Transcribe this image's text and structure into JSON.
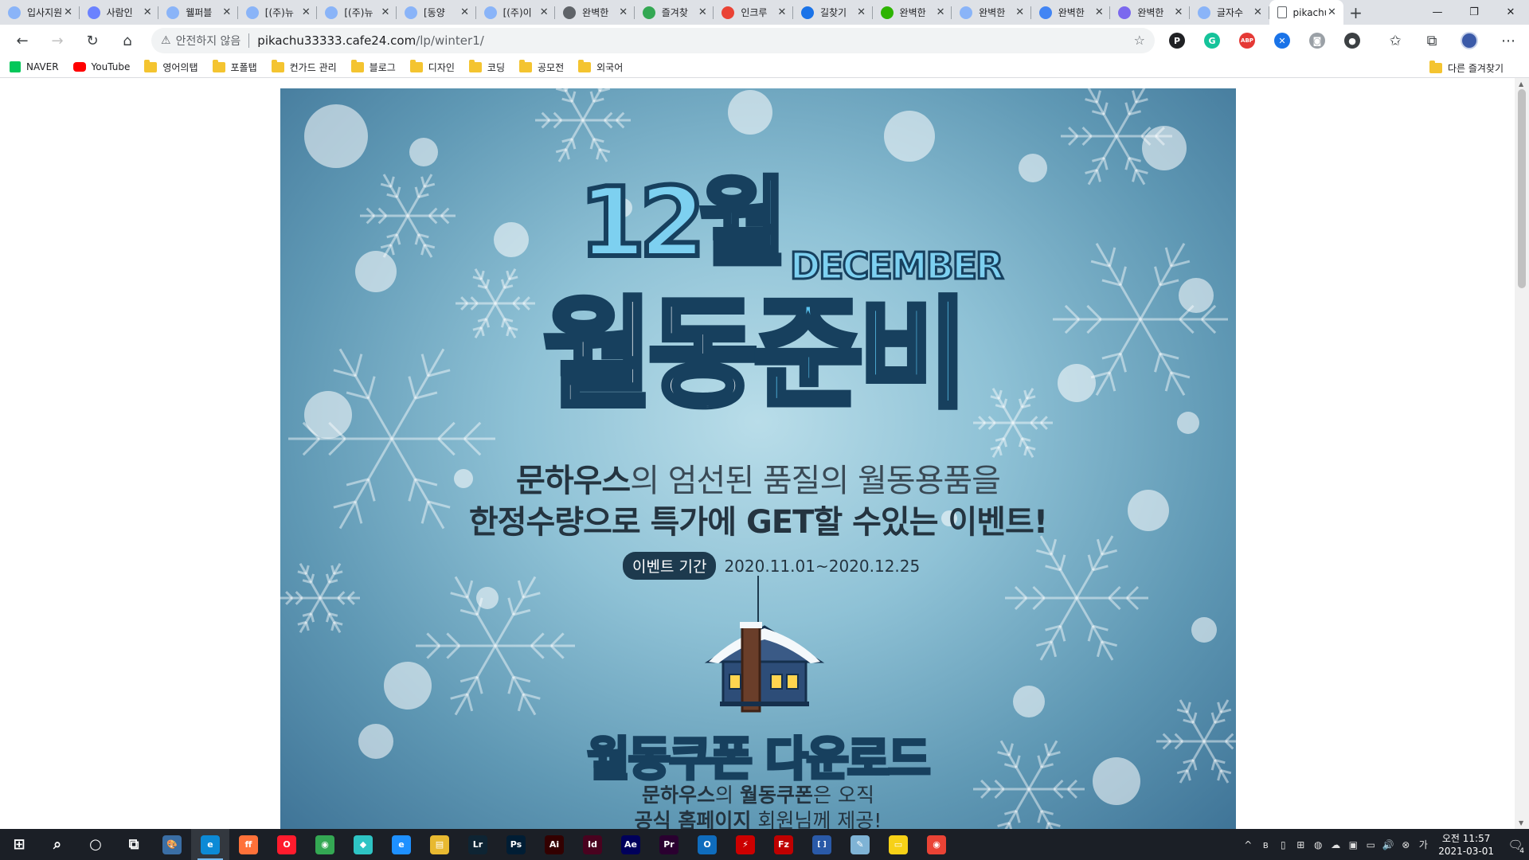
{
  "tabs": [
    {
      "title": "입사지원",
      "color": "#8ab4f8"
    },
    {
      "title": "사람인",
      "color": "#6b82ff"
    },
    {
      "title": "웰퍼블",
      "color": "#8ab4f8"
    },
    {
      "title": "[(주)뉴",
      "color": "#8ab4f8"
    },
    {
      "title": "[(주)뉴",
      "color": "#8ab4f8"
    },
    {
      "title": "[동양",
      "color": "#8ab4f8"
    },
    {
      "title": "[(주)이",
      "color": "#8ab4f8"
    },
    {
      "title": "완벽한",
      "color": "#5f6368"
    },
    {
      "title": "즐겨찾",
      "color": "#34a853"
    },
    {
      "title": "인크루",
      "color": "#ea4335"
    },
    {
      "title": "길찾기",
      "color": "#1a73e8"
    },
    {
      "title": "완벽한",
      "color": "#2db400"
    },
    {
      "title": "완벽한",
      "color": "#8ab4f8"
    },
    {
      "title": "완벽한",
      "color": "#4285f4"
    },
    {
      "title": "완벽한",
      "color": "#7b68ee"
    },
    {
      "title": "글자수",
      "color": "#8ab4f8"
    }
  ],
  "active_tab": {
    "title": "pikachu",
    "close": "✕"
  },
  "tab_close": "✕",
  "new_tab": "+",
  "window_controls": {
    "minimize": "—",
    "maximize": "❐",
    "close": "✕"
  },
  "toolbar": {
    "back": "←",
    "forward": "→",
    "reload": "↻",
    "home": "⌂",
    "security_icon": "⚠",
    "security_text": "안전하지 않음",
    "url_host": "pikachu33333.cafe24.com",
    "url_path": "/lp/winter1/",
    "star": "☆",
    "extensions": [
      {
        "name": "extension-p-icon",
        "label": "P",
        "color": "#202124"
      },
      {
        "name": "extension-grammarly-icon",
        "label": "G",
        "color": "#15c39a"
      },
      {
        "name": "extension-adblock-icon",
        "label": "ABP",
        "color": "#e53935"
      },
      {
        "name": "extension-x-icon",
        "label": "✕",
        "color": "#1a73e8"
      },
      {
        "name": "extension-camera-icon",
        "label": "◙",
        "color": "#9aa0a6"
      },
      {
        "name": "extension-circle-icon",
        "label": "●",
        "color": "#3c4043"
      }
    ],
    "favorites": "✩",
    "collections": "⧉",
    "menu": "⋯"
  },
  "bookmarks": [
    {
      "label": "NAVER",
      "type": "naver"
    },
    {
      "label": "YouTube",
      "type": "youtube"
    },
    {
      "label": "영어의탭",
      "type": "folder"
    },
    {
      "label": "포폴탭",
      "type": "folder"
    },
    {
      "label": "컨가드 관리",
      "type": "folder"
    },
    {
      "label": "블로그",
      "type": "folder"
    },
    {
      "label": "디자인",
      "type": "folder"
    },
    {
      "label": "코딩",
      "type": "folder"
    },
    {
      "label": "공모전",
      "type": "folder"
    },
    {
      "label": "외국어",
      "type": "folder"
    }
  ],
  "other_bookmarks": "다른 즐겨찾기",
  "banner": {
    "month": "12월",
    "month_en": "DECEMBER",
    "headline_white": "월동",
    "headline_blue": "준비",
    "line1_bold": "문하우스",
    "line1_rest": "의 엄선된 품질의 월동용품을",
    "line2": "한정수량으로 특가에 GET할 수있는 이벤트!",
    "period_label": "이벤트 기간",
    "period_dates": "2020.11.01~2020.12.25",
    "coupon_title": "월동쿠폰 다운로드",
    "coupon_line1_bold_a": "문하우스",
    "coupon_line1_mid": "의 ",
    "coupon_line1_bold_b": "월동쿠폰",
    "coupon_line1_rest": "은 오직",
    "coupon_line2_bold": "공식 홈페이지",
    "coupon_line2_rest": " 회원님께 제공!"
  },
  "taskbar": {
    "apps": [
      {
        "name": "start-icon",
        "label": "⊞",
        "color": "transparent"
      },
      {
        "name": "search-icon",
        "label": "⌕",
        "color": "transparent"
      },
      {
        "name": "cortana-icon",
        "label": "○",
        "color": "transparent"
      },
      {
        "name": "task-view-icon",
        "label": "⧉",
        "color": "transparent"
      },
      {
        "name": "paint-app-icon",
        "label": "🎨",
        "color": "#3a6ea5"
      },
      {
        "name": "edge-app-icon",
        "label": "e",
        "color": "#0c8ad6"
      },
      {
        "name": "firefox-app-icon",
        "label": "ff",
        "color": "#ff7139"
      },
      {
        "name": "opera-app-icon",
        "label": "O",
        "color": "#ff1b2d"
      },
      {
        "name": "chrome-app-icon",
        "label": "◉",
        "color": "#34a853"
      },
      {
        "name": "bird-app-icon",
        "label": "◆",
        "color": "#2ec4c4"
      },
      {
        "name": "ie-app-icon",
        "label": "e",
        "color": "#1e90ff"
      },
      {
        "name": "explorer-app-icon",
        "label": "▤",
        "color": "#e8b931"
      },
      {
        "name": "lightroom-app-icon",
        "label": "Lr",
        "color": "#0e2433"
      },
      {
        "name": "photoshop-app-icon",
        "label": "Ps",
        "color": "#001d34"
      },
      {
        "name": "illustrator-app-icon",
        "label": "Ai",
        "color": "#330000"
      },
      {
        "name": "indesign-app-icon",
        "label": "Id",
        "color": "#49021f"
      },
      {
        "name": "aftereffects-app-icon",
        "label": "Ae",
        "color": "#00005b"
      },
      {
        "name": "premiere-app-icon",
        "label": "Pr",
        "color": "#2a0030"
      },
      {
        "name": "outlook-app-icon",
        "label": "O",
        "color": "#0f6cbd"
      },
      {
        "name": "flash-app-icon",
        "label": "⚡",
        "color": "#cc0000"
      },
      {
        "name": "filezilla-app-icon",
        "label": "Fz",
        "color": "#bf0000"
      },
      {
        "name": "brackets-app-icon",
        "label": "[ ]",
        "color": "#2a5aa8"
      },
      {
        "name": "notepad-app-icon",
        "label": "✎",
        "color": "#7fb3d5"
      },
      {
        "name": "sticky-notes-app-icon",
        "label": "▭",
        "color": "#f7d117"
      },
      {
        "name": "chrome2-app-icon",
        "label": "◉",
        "color": "#ea4335"
      }
    ],
    "tray_icons": [
      "^",
      "ʙ",
      "▯",
      "⊞",
      "◍",
      "☁",
      "▣",
      "▭",
      "🔊",
      "⊗",
      "가"
    ],
    "clock_time": "오전 11:57",
    "clock_date": "2021-03-01",
    "notification": "🗨",
    "notification_count": "4"
  }
}
